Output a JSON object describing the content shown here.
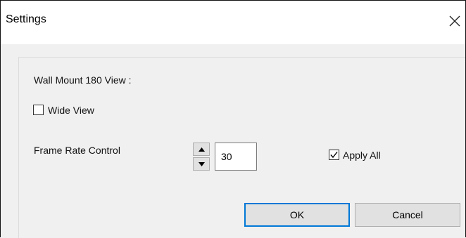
{
  "window": {
    "title": "Settings",
    "close_icon": "close-icon"
  },
  "form": {
    "section_label": "Wall Mount 180 View :",
    "wide_view": {
      "label": "Wide View",
      "checked": false
    },
    "frame_rate": {
      "label": "Frame Rate Control",
      "value": "30",
      "up_icon": "arrow-up-icon",
      "down_icon": "arrow-down-icon"
    },
    "apply_all": {
      "label": "Apply All",
      "checked": true
    }
  },
  "buttons": {
    "ok_label": "OK",
    "cancel_label": "Cancel"
  },
  "colors": {
    "focus_accent": "#0078d7",
    "button_face": "#e1e1e1",
    "client_background": "#f0f0f0"
  }
}
